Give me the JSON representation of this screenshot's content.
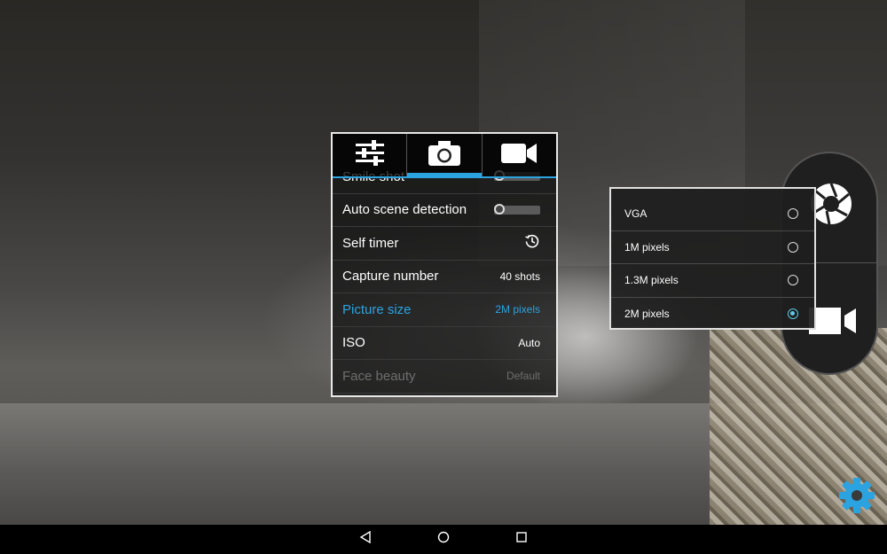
{
  "settings": {
    "tabs": [
      {
        "icon": "sliders-icon",
        "active": false
      },
      {
        "icon": "camera-icon",
        "active": true
      },
      {
        "icon": "video-camera-icon",
        "active": false
      }
    ],
    "rows": [
      {
        "label": "Smile shot",
        "type": "toggle",
        "value": ""
      },
      {
        "label": "Auto scene detection",
        "type": "toggle",
        "value": ""
      },
      {
        "label": "Self timer",
        "type": "icon",
        "value": ""
      },
      {
        "label": "Capture number",
        "type": "text",
        "value": "40 shots"
      },
      {
        "label": "Picture size",
        "type": "text",
        "value": "2M pixels"
      },
      {
        "label": "ISO",
        "type": "text",
        "value": "Auto"
      },
      {
        "label": "Face beauty",
        "type": "text",
        "value": "Default"
      }
    ]
  },
  "picture_size_popup": {
    "options": [
      {
        "label": "VGA",
        "selected": false
      },
      {
        "label": "1M pixels",
        "selected": false
      },
      {
        "label": "1.3M pixels",
        "selected": false
      },
      {
        "label": "2M pixels",
        "selected": true
      }
    ]
  },
  "colors": {
    "accent": "#2ba3e0",
    "radio_selected": "#5ec8e6"
  },
  "icons": {
    "shutter": "aperture-icon",
    "video": "video-camera-icon",
    "settings": "gear-icon",
    "nav_back": "back-icon",
    "nav_home": "home-icon",
    "nav_recent": "recent-apps-icon",
    "self_timer": "timer-icon"
  }
}
